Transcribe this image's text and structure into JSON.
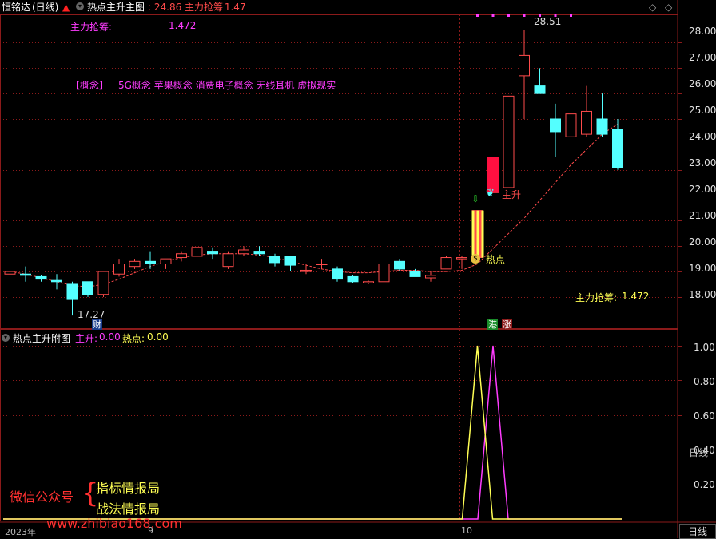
{
  "header": {
    "stock_name": "恒铭达",
    "period": "(日线)",
    "indicator_name": "热点主升主图",
    "value_main": ": 24.86",
    "value_label": "主力抢筹",
    "value_num": ": 1.47"
  },
  "main_pane": {
    "label_topleft_name": "主力抢筹:",
    "label_topleft_value": "1.472",
    "concepts_tag": "【概念】",
    "concepts": "5G概念  苹果概念  消费电子概念  无线耳机  虚拟现实",
    "label_right_name": "主力抢筹:",
    "label_right_value": "1.472",
    "high_label": "28.51",
    "low_label": "17.27",
    "finance_badge": "财",
    "signal_zhusheng": "主升",
    "signal_redian": "热点",
    "badge_gang": "港",
    "badge_zhang": "涨",
    "y_ticks": [
      "28.00",
      "27.00",
      "26.00",
      "25.00",
      "24.00",
      "23.00",
      "22.00",
      "21.00",
      "20.00",
      "19.00",
      "18.00"
    ]
  },
  "sub_pane": {
    "title": "热点主升附图",
    "zhusheng_label": "主升:",
    "zhusheng_value": "0.00",
    "redian_label": "热点:",
    "redian_value": "0.00",
    "y_ticks": [
      "1.00",
      "0.80",
      "0.60",
      "0.40",
      "0.20"
    ],
    "watermark_left": "微信公众号",
    "watermark_line1": "指标情报局",
    "watermark_line2": "战法情报局",
    "watermark_url": "www.zhibiao168.com"
  },
  "axis": {
    "date_left": "2023年",
    "date_mid": "9",
    "date_right": "10",
    "period_button": "日线"
  },
  "colors": {
    "up": "#ff4b4b",
    "down": "#54ffff",
    "ma": "#ff4b4b",
    "magenta": "#ff3cff",
    "yellow": "#ffff54",
    "grid": "#8b1a1a"
  },
  "chart_data": {
    "type": "candlestick",
    "candles": [
      {
        "o": 18.9,
        "h": 19.3,
        "l": 18.8,
        "c": 19.0
      },
      {
        "o": 18.9,
        "h": 19.2,
        "l": 18.6,
        "c": 18.85
      },
      {
        "o": 18.8,
        "h": 18.85,
        "l": 18.6,
        "c": 18.7
      },
      {
        "o": 18.65,
        "h": 18.9,
        "l": 18.3,
        "c": 18.6
      },
      {
        "o": 18.5,
        "h": 18.6,
        "l": 17.27,
        "c": 17.9
      },
      {
        "o": 18.6,
        "h": 18.6,
        "l": 18.0,
        "c": 18.1
      },
      {
        "o": 18.1,
        "h": 19.0,
        "l": 18.0,
        "c": 19.0
      },
      {
        "o": 18.9,
        "h": 19.5,
        "l": 18.8,
        "c": 19.3
      },
      {
        "o": 19.2,
        "h": 19.5,
        "l": 19.1,
        "c": 19.4
      },
      {
        "o": 19.4,
        "h": 19.8,
        "l": 19.1,
        "c": 19.3
      },
      {
        "o": 19.3,
        "h": 19.5,
        "l": 19.1,
        "c": 19.5
      },
      {
        "o": 19.55,
        "h": 19.8,
        "l": 19.4,
        "c": 19.7
      },
      {
        "o": 19.6,
        "h": 20.0,
        "l": 19.5,
        "c": 19.95
      },
      {
        "o": 19.8,
        "h": 19.95,
        "l": 19.5,
        "c": 19.7
      },
      {
        "o": 19.2,
        "h": 19.8,
        "l": 19.1,
        "c": 19.7
      },
      {
        "o": 19.7,
        "h": 20.0,
        "l": 19.6,
        "c": 19.85
      },
      {
        "o": 19.8,
        "h": 20.0,
        "l": 19.6,
        "c": 19.7
      },
      {
        "o": 19.6,
        "h": 19.7,
        "l": 19.2,
        "c": 19.35
      },
      {
        "o": 19.6,
        "h": 19.6,
        "l": 19.0,
        "c": 19.25
      },
      {
        "o": 19.0,
        "h": 19.3,
        "l": 18.9,
        "c": 19.05
      },
      {
        "o": 19.3,
        "h": 19.5,
        "l": 19.1,
        "c": 19.3
      },
      {
        "o": 19.1,
        "h": 19.2,
        "l": 18.6,
        "c": 18.7
      },
      {
        "o": 18.8,
        "h": 18.85,
        "l": 18.55,
        "c": 18.6
      },
      {
        "o": 18.55,
        "h": 18.65,
        "l": 18.5,
        "c": 18.6
      },
      {
        "o": 18.6,
        "h": 19.5,
        "l": 18.5,
        "c": 19.3
      },
      {
        "o": 19.4,
        "h": 19.5,
        "l": 19.0,
        "c": 19.1
      },
      {
        "o": 19.0,
        "h": 19.1,
        "l": 18.8,
        "c": 18.8
      },
      {
        "o": 18.75,
        "h": 19.0,
        "l": 18.6,
        "c": 18.85
      },
      {
        "o": 19.1,
        "h": 19.6,
        "l": 19.1,
        "c": 19.55
      },
      {
        "o": 19.5,
        "h": 19.6,
        "l": 19.1,
        "c": 19.55
      },
      {
        "o": 19.55,
        "h": 21.4,
        "l": 19.5,
        "c": 21.4
      },
      {
        "o": 22.1,
        "h": 23.5,
        "l": 22.1,
        "c": 23.5
      },
      {
        "o": 22.3,
        "h": 25.9,
        "l": 22.3,
        "c": 25.9
      },
      {
        "o": 26.7,
        "h": 28.51,
        "l": 25.0,
        "c": 27.5
      },
      {
        "o": 26.3,
        "h": 27.0,
        "l": 26.0,
        "c": 26.0
      },
      {
        "o": 25.0,
        "h": 25.6,
        "l": 23.5,
        "c": 24.5
      },
      {
        "o": 24.3,
        "h": 25.6,
        "l": 24.2,
        "c": 25.2
      },
      {
        "o": 24.4,
        "h": 26.3,
        "l": 24.3,
        "c": 25.3
      },
      {
        "o": 25.0,
        "h": 26.0,
        "l": 24.3,
        "c": 24.4
      },
      {
        "o": 24.6,
        "h": 25.0,
        "l": 23.0,
        "c": 23.1
      }
    ],
    "highlight_bars": [
      {
        "index": 30,
        "from": 19.55,
        "to": 21.4,
        "style": "yellow-red-stripe"
      },
      {
        "index": 31,
        "from": 22.1,
        "to": 23.5,
        "style": "red-fill"
      }
    ],
    "ma_line": [
      19.0,
      18.9,
      18.75,
      18.6,
      18.45,
      18.4,
      18.5,
      18.7,
      18.95,
      19.2,
      19.4,
      19.55,
      19.65,
      19.7,
      19.7,
      19.7,
      19.65,
      19.55,
      19.4,
      19.25,
      19.1,
      19.0,
      18.95,
      18.95,
      19.0,
      19.05,
      19.05,
      19.0,
      19.0,
      19.05,
      19.3,
      19.9,
      20.5,
      21.1,
      21.8,
      22.5,
      23.2,
      23.8,
      24.4,
      24.8
    ],
    "price_ylim": [
      17.4,
      28.8
    ],
    "sub_series": [
      {
        "name": "主升",
        "color": "#ff3cff",
        "peak_index": 31,
        "values": "0 except 1.00 at peak"
      },
      {
        "name": "热点",
        "color": "#ffff54",
        "peak_index": 30,
        "values": "0 except 1.00 at peak"
      }
    ],
    "sub_ylim": [
      0,
      1.05
    ]
  }
}
